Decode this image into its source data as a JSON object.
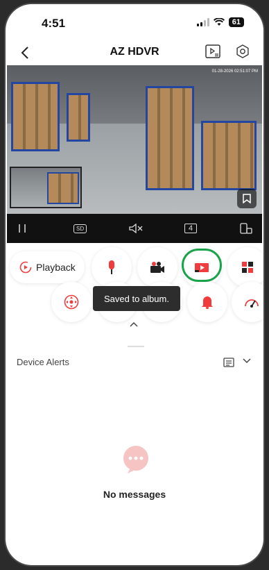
{
  "status": {
    "time": "4:51",
    "battery": "61"
  },
  "header": {
    "title": "AZ HDVR"
  },
  "video": {
    "timestamp": "01-28-2026 02:51:07 PM"
  },
  "controls": {
    "sd_label": "SD",
    "split_label": "4"
  },
  "features": {
    "playback_label": "Playback"
  },
  "toast": {
    "message": "Saved to album."
  },
  "alerts": {
    "label": "Device Alerts"
  },
  "empty": {
    "message": "No messages"
  },
  "colors": {
    "accent": "#f03c3c",
    "highlight": "#1aa34a",
    "toast_bg": "#2d2d2d"
  }
}
